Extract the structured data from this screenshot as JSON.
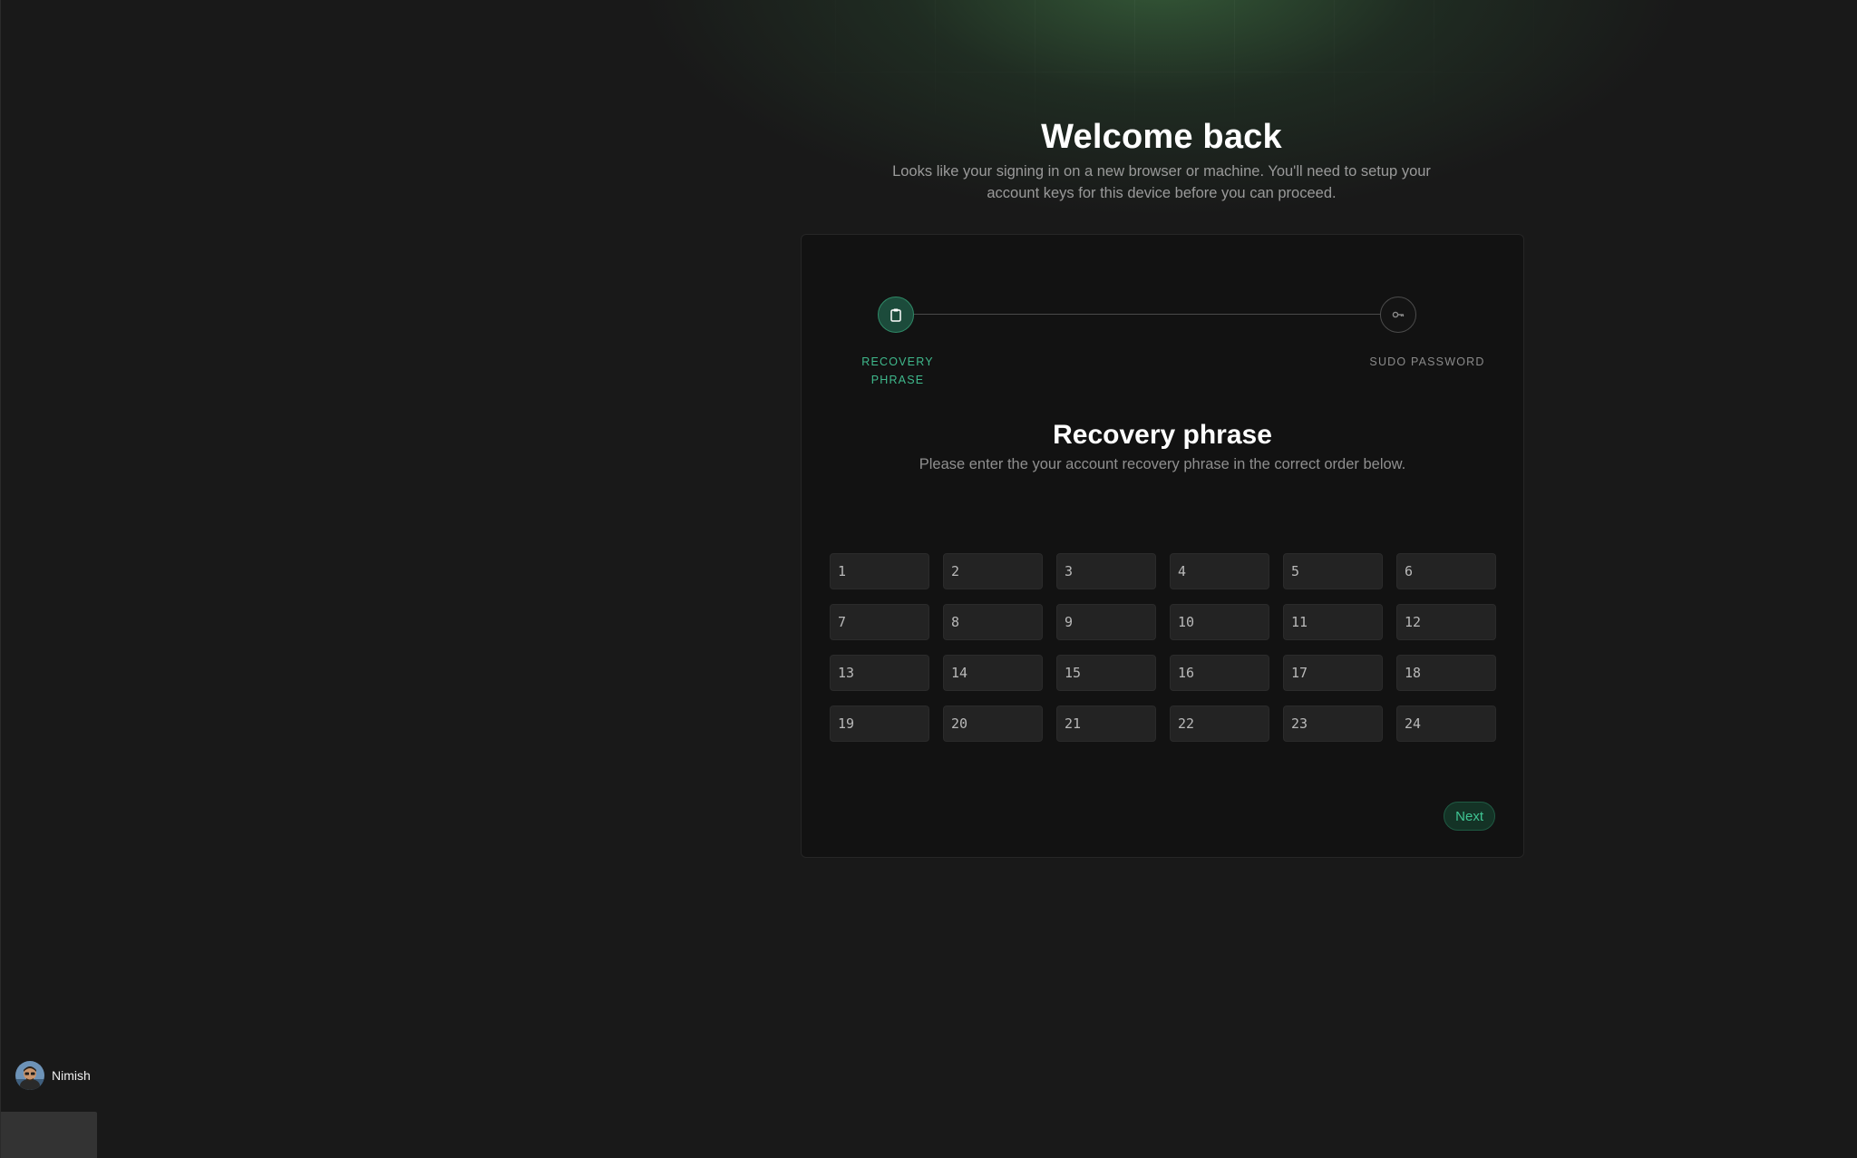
{
  "header": {
    "title": "Welcome back",
    "subtitle": "Looks like your signing in on a new browser or machine. You'll need to setup your account keys for this device before you can proceed."
  },
  "stepper": {
    "steps": [
      {
        "label": "RECOVERY PHRASE",
        "icon": "clipboard-icon",
        "state": "active"
      },
      {
        "label": "SUDO PASSWORD",
        "icon": "key-icon",
        "state": "inactive"
      }
    ]
  },
  "recovery": {
    "title": "Recovery phrase",
    "description": "Please enter the your account recovery phrase in the correct order below.",
    "word_placeholders": [
      "1",
      "2",
      "3",
      "4",
      "5",
      "6",
      "7",
      "8",
      "9",
      "10",
      "11",
      "12",
      "13",
      "14",
      "15",
      "16",
      "17",
      "18",
      "19",
      "20",
      "21",
      "22",
      "23",
      "24"
    ]
  },
  "actions": {
    "next_label": "Next"
  },
  "user": {
    "name": "Nimish",
    "avatar_icon": "user-avatar"
  },
  "colors": {
    "background": "#191919",
    "card": "#121212",
    "accent": "#3fb98c",
    "input_bg": "#232323"
  }
}
